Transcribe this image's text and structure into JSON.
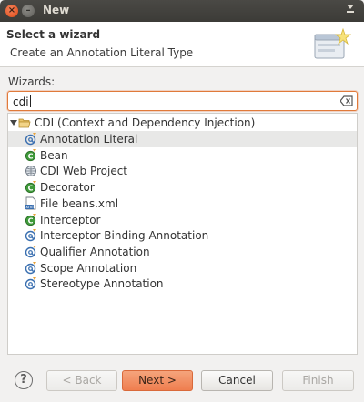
{
  "window": {
    "title": "New",
    "close_glyph": "×",
    "minimize_glyph": "–"
  },
  "banner": {
    "title": "Select a wizard",
    "description": "Create an Annotation Literal Type"
  },
  "wizards_label": "Wizards:",
  "filter": {
    "value": "cdi"
  },
  "tree": {
    "category": {
      "label": "CDI (Context and Dependency Injection)",
      "expanded": true
    },
    "items": [
      {
        "label": "Annotation Literal",
        "icon": "annotation-icon",
        "selected": true
      },
      {
        "label": "Bean",
        "icon": "bean-icon",
        "selected": false
      },
      {
        "label": "CDI Web Project",
        "icon": "web-project-icon",
        "selected": false
      },
      {
        "label": "Decorator",
        "icon": "bean-icon",
        "selected": false
      },
      {
        "label": "File beans.xml",
        "icon": "xml-file-icon",
        "selected": false
      },
      {
        "label": "Interceptor",
        "icon": "bean-icon",
        "selected": false
      },
      {
        "label": "Interceptor Binding Annotation",
        "icon": "annotation-icon",
        "selected": false
      },
      {
        "label": "Qualifier Annotation",
        "icon": "annotation-icon",
        "selected": false
      },
      {
        "label": "Scope Annotation",
        "icon": "annotation-icon",
        "selected": false
      },
      {
        "label": "Stereotype Annotation",
        "icon": "annotation-icon",
        "selected": false
      }
    ]
  },
  "buttons": {
    "help": "?",
    "back": "< Back",
    "next": "Next >",
    "cancel": "Cancel",
    "finish": "Finish"
  },
  "colors": {
    "accent": "#ef7e4f",
    "focus_border": "#e07a3a",
    "selection": "#e8e8e7"
  }
}
